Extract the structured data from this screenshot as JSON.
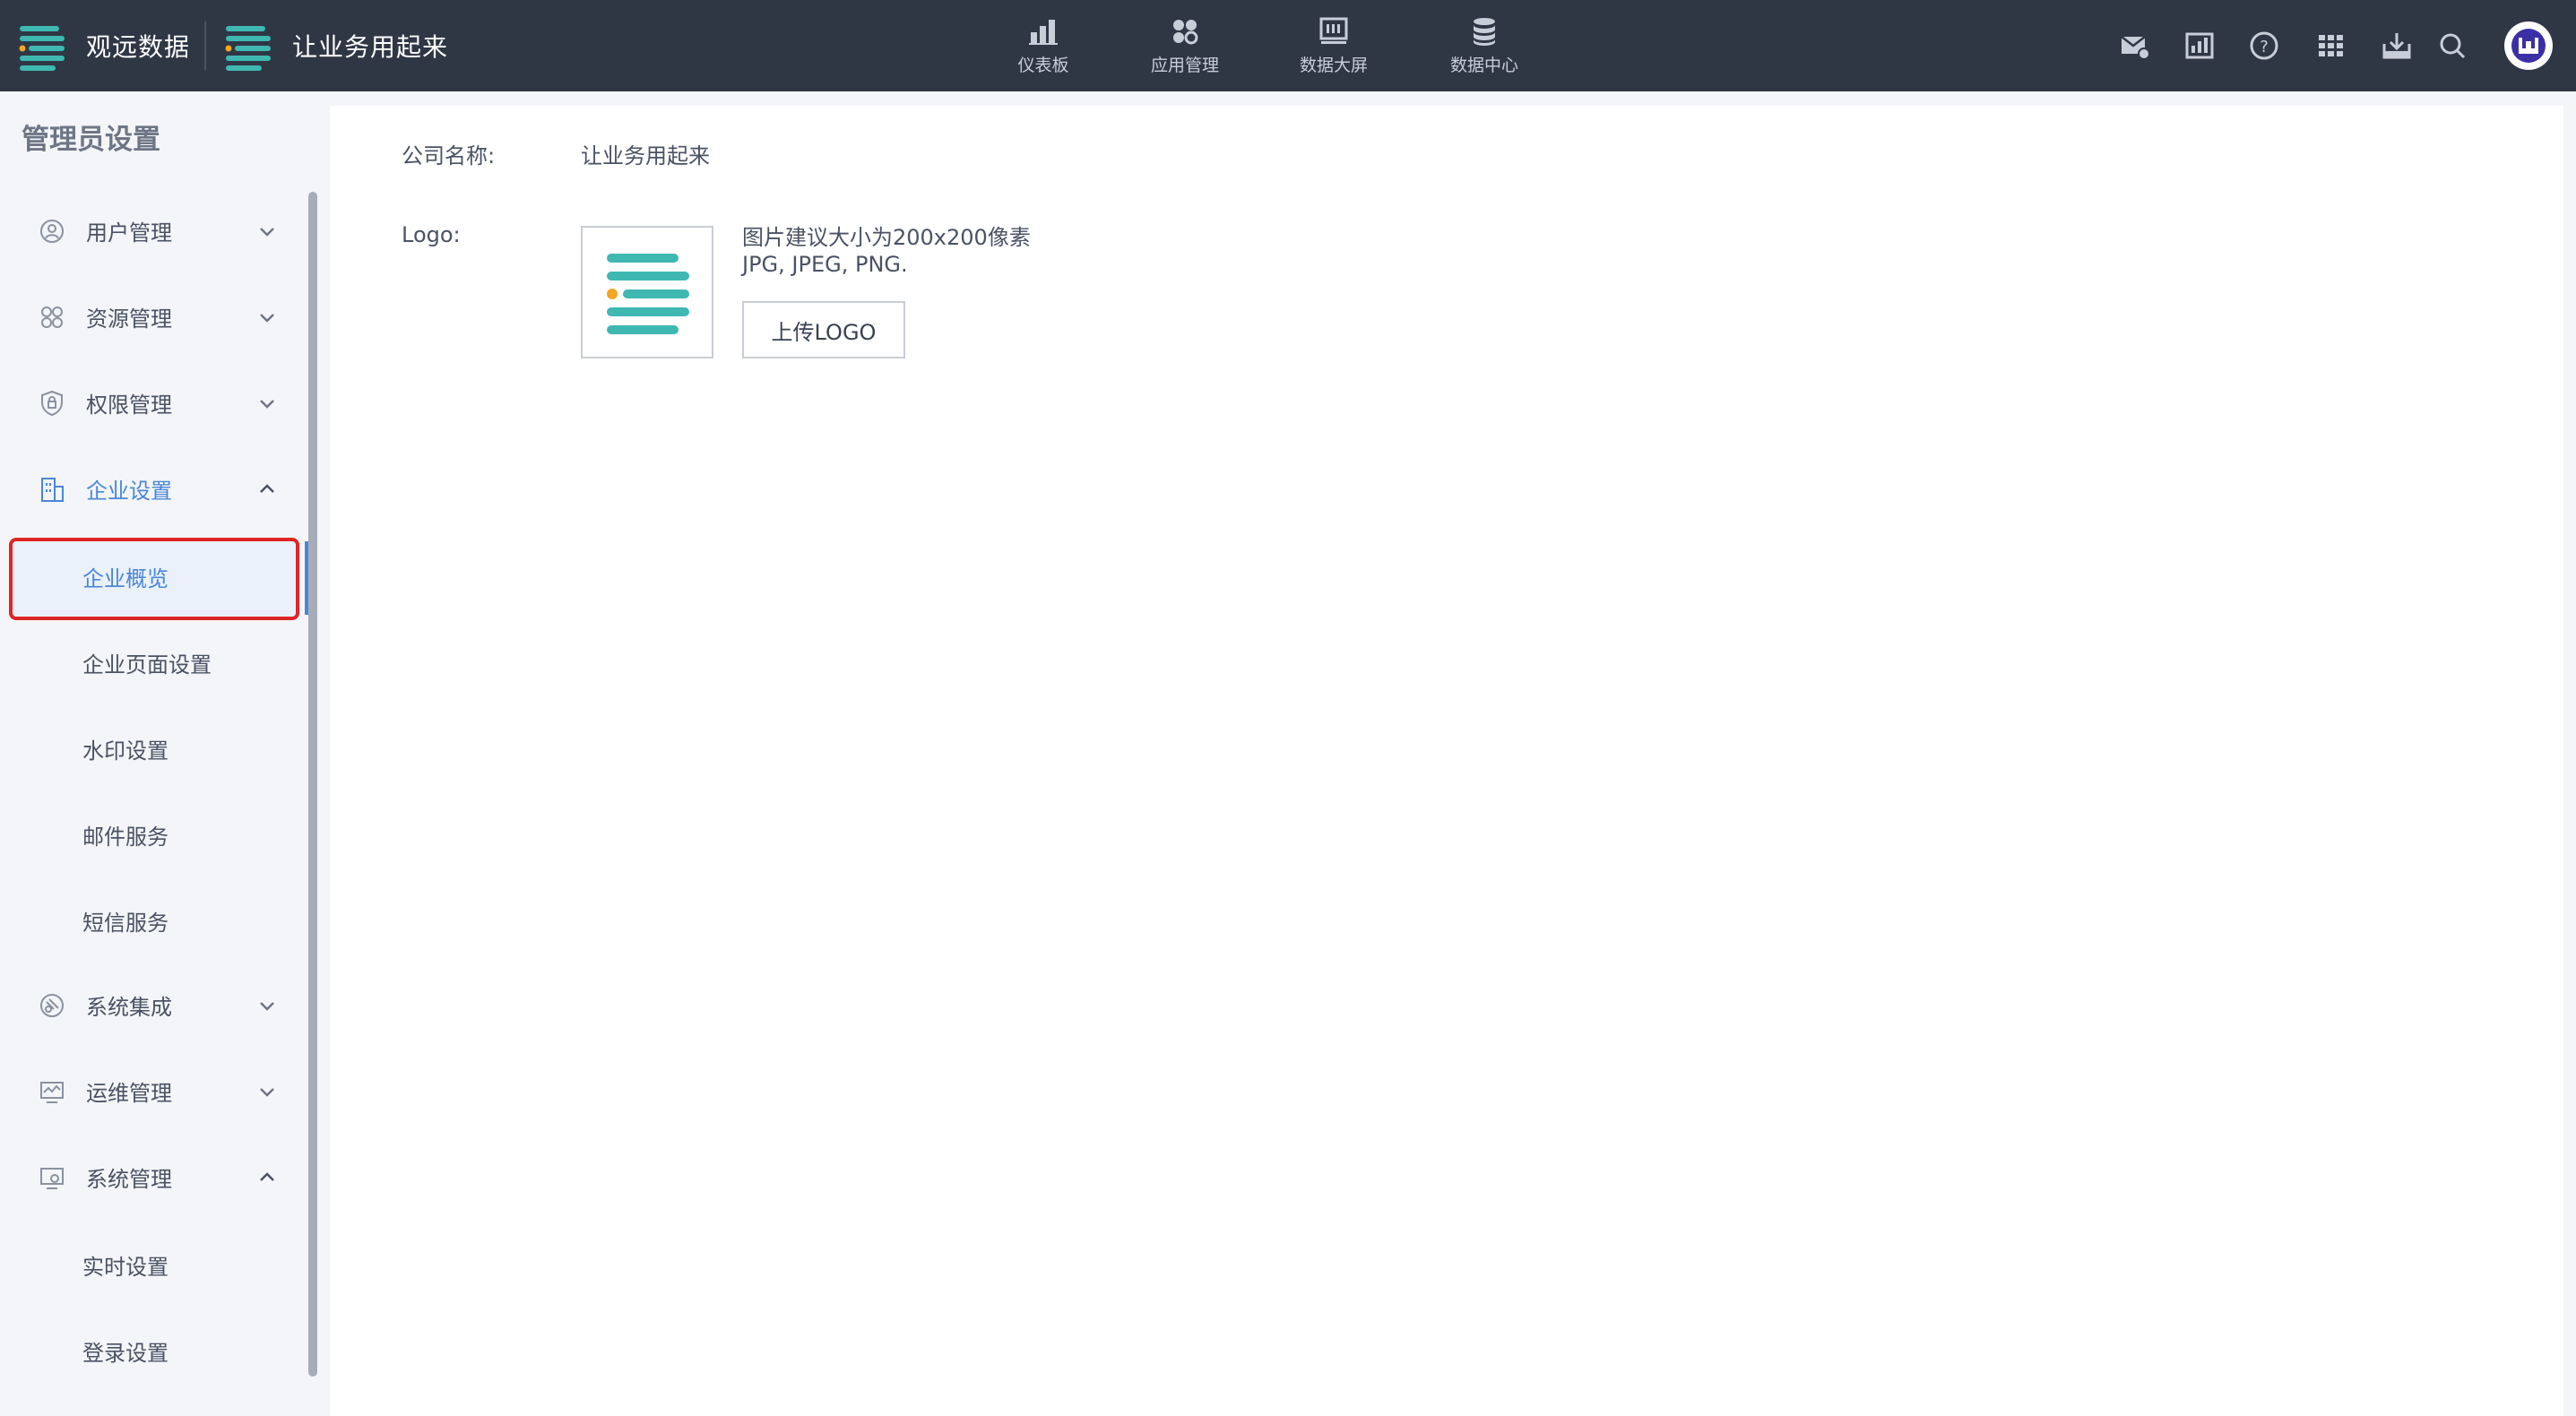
{
  "header": {
    "brand_primary": "观远数据",
    "brand_secondary": "让业务用起来",
    "nav": [
      {
        "label": "仪表板",
        "icon": "bar-chart-icon"
      },
      {
        "label": "应用管理",
        "icon": "apps-grid-icon"
      },
      {
        "label": "数据大屏",
        "icon": "monitor-icon"
      },
      {
        "label": "数据中心",
        "icon": "database-icon"
      }
    ],
    "tools": [
      "mail-settings-icon",
      "report-icon",
      "help-icon",
      "app-grid-icon",
      "download-icon",
      "search-icon"
    ]
  },
  "sidebar": {
    "title": "管理员设置",
    "menu": [
      {
        "label": "用户管理",
        "icon": "user-icon",
        "state": "collapsed"
      },
      {
        "label": "资源管理",
        "icon": "resource-icon",
        "state": "collapsed"
      },
      {
        "label": "权限管理",
        "icon": "shield-icon",
        "state": "collapsed"
      },
      {
        "label": "企业设置",
        "icon": "building-icon",
        "state": "expanded"
      },
      {
        "label": "系统集成",
        "icon": "integration-icon",
        "state": "collapsed"
      },
      {
        "label": "运维管理",
        "icon": "monitor-ops-icon",
        "state": "collapsed"
      },
      {
        "label": "系统管理",
        "icon": "system-icon",
        "state": "expanded"
      }
    ],
    "enterprise_sub": [
      "企业概览",
      "企业页面设置",
      "水印设置",
      "邮件服务",
      "短信服务"
    ],
    "system_sub": [
      "实时设置",
      "登录设置"
    ],
    "active_item": "企业概览"
  },
  "content": {
    "company_name_label": "公司名称:",
    "company_name_value": "让业务用起来",
    "logo_label": "Logo:",
    "hint_line1": "图片建议大小为200x200像素",
    "hint_line2": "JPG, JPEG, PNG.",
    "upload_button": "上传LOGO"
  },
  "colors": {
    "topbar": "#2f3745",
    "accent": "#4a86d8",
    "logo_teal": "#3fb8b2",
    "logo_orange": "#f5a623",
    "highlight": "#e02525"
  }
}
